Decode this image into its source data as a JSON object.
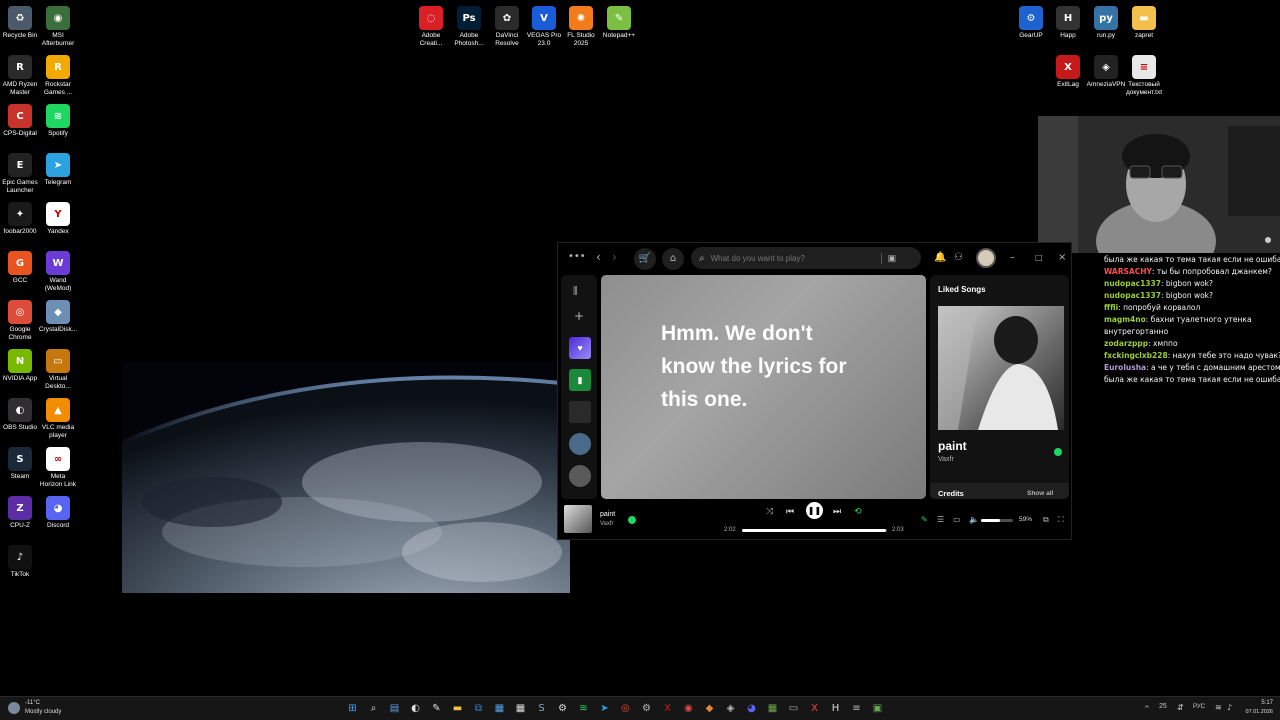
{
  "desktop": {
    "left_icons": [
      {
        "label": "Recycle Bin",
        "icon": "recycle-bin-icon",
        "color": "#4a5a6a",
        "glyph": "♻"
      },
      {
        "label": "MSI\nAfterburner",
        "icon": "msi-afterburner-icon",
        "color": "#3a6e3a",
        "glyph": "◉"
      },
      {
        "label": "AMD Ryzen\nMaster",
        "icon": "amd-ryzen-icon",
        "color": "#2a2a2a",
        "glyph": "R"
      },
      {
        "label": "Rockstar\nGames ...",
        "icon": "rockstar-icon",
        "color": "#f2a900",
        "glyph": "R"
      },
      {
        "label": "CPS-Digital",
        "icon": "cps-digital-icon",
        "color": "#c8332b",
        "glyph": "C"
      },
      {
        "label": "Spotify",
        "icon": "spotify-icon",
        "color": "#1ed760",
        "glyph": "≋"
      },
      {
        "label": "Epic Games\nLauncher",
        "icon": "epic-games-icon",
        "color": "#222222",
        "glyph": "E"
      },
      {
        "label": "Telegram",
        "icon": "telegram-icon",
        "color": "#2aa3e0",
        "glyph": "➤"
      },
      {
        "label": "foobar2000",
        "icon": "foobar-icon",
        "color": "#1a1a1a",
        "glyph": "✦"
      },
      {
        "label": "Yandex",
        "icon": "yandex-icon",
        "color": "#ffffff",
        "glyph": "Y"
      },
      {
        "label": "GCC",
        "icon": "gcc-icon",
        "color": "#e8531f",
        "glyph": "G"
      },
      {
        "label": "Wand\n(WeMod)",
        "icon": "wand-icon",
        "color": "#6b3bd8",
        "glyph": "W"
      },
      {
        "label": "Google\nChrome",
        "icon": "chrome-icon",
        "color": "#dd4b39",
        "glyph": "◎"
      },
      {
        "label": "CrystalDisk...",
        "icon": "crystaldisk-icon",
        "color": "#6c8fb5",
        "glyph": "◆"
      },
      {
        "label": "NVIDIA App",
        "icon": "nvidia-icon",
        "color": "#76b900",
        "glyph": "N"
      },
      {
        "label": "Virtual\nDeskto...",
        "icon": "virtual-desktop-icon",
        "color": "#c6780e",
        "glyph": "▭"
      },
      {
        "label": "OBS Studio",
        "icon": "obs-icon",
        "color": "#302e31",
        "glyph": "◐"
      },
      {
        "label": "VLC media\nplayer",
        "icon": "vlc-icon",
        "color": "#f28c00",
        "glyph": "▲"
      },
      {
        "label": "Steam",
        "icon": "steam-icon",
        "color": "#1b2838",
        "glyph": "S"
      },
      {
        "label": "Meta\nHorizon Link",
        "icon": "meta-icon",
        "color": "#ffffff",
        "glyph": "∞"
      },
      {
        "label": "CPU-Z",
        "icon": "cpuz-icon",
        "color": "#5b2ea6",
        "glyph": "Z"
      },
      {
        "label": "Discord",
        "icon": "discord-icon",
        "color": "#5865f2",
        "glyph": "◕"
      },
      {
        "label": "TikTok",
        "icon": "tiktok-icon",
        "color": "#111111",
        "glyph": "♪"
      }
    ],
    "top_icons": [
      {
        "label": "Adobe\nCreati...",
        "icon": "adobe-cc-icon",
        "color": "#da1f26",
        "glyph": "◌"
      },
      {
        "label": "Adobe\nPhotosh...",
        "icon": "photoshop-icon",
        "color": "#001e36",
        "glyph": "Ps"
      },
      {
        "label": "DaVinci\nResolve",
        "icon": "davinci-icon",
        "color": "#2b2b2b",
        "glyph": "✿"
      },
      {
        "label": "VEGAS Pro\n23.0",
        "icon": "vegas-icon",
        "color": "#1a5bd8",
        "glyph": "V"
      },
      {
        "label": "FL Studio\n2025",
        "icon": "fl-studio-icon",
        "color": "#f27b1b",
        "glyph": "✺"
      },
      {
        "label": "Notepad++",
        "icon": "notepad-icon",
        "color": "#7bc043",
        "glyph": "✎"
      }
    ],
    "right_icons": [
      {
        "label": "GearUP",
        "icon": "gearup-icon",
        "color": "#1e62d0",
        "glyph": "⚙"
      },
      {
        "label": "Happ",
        "icon": "happ-icon",
        "color": "#333333",
        "glyph": "H"
      },
      {
        "label": "run.py",
        "icon": "python-file-icon",
        "color": "#3572a5",
        "glyph": "py"
      },
      {
        "label": "zapret",
        "icon": "folder-icon",
        "color": "#f3c14b",
        "glyph": "▬"
      },
      {
        "label": "ExitLag",
        "icon": "exitlag-icon",
        "color": "#c61a1a",
        "glyph": "X"
      },
      {
        "label": "AmneziaVPN",
        "icon": "amnezia-icon",
        "color": "#222222",
        "glyph": "◈"
      },
      {
        "label": "Текстовый\nдокумент.txt",
        "icon": "text-file-icon",
        "color": "#e8e8e8",
        "glyph": "≡"
      }
    ]
  },
  "chat": {
    "messages": [
      {
        "nick": "",
        "text": "была же какая то тема такая если не ошибаюсь",
        "color": "#ffffff"
      },
      {
        "nick": "WARSACHY",
        "text": ": ты бы попробовал джанкем?",
        "color": "#ff4d4d"
      },
      {
        "nick": "nudopac1337",
        "text": ": bigbon wok?",
        "color": "#9acd32"
      },
      {
        "nick": "nudopac1337",
        "text": ": bigbon wok?",
        "color": "#9acd32"
      },
      {
        "nick": "fffii",
        "text": ": попробуй корвалол",
        "color": "#9acd32"
      },
      {
        "nick": "magm4no",
        "text": ": бахни туалетного утенка",
        "color": "#9acd32"
      },
      {
        "nick": "",
        "text": "внутрегортанно",
        "color": "#ffffff"
      },
      {
        "nick": "zodarzppp",
        "text": ": хмппо",
        "color": "#9acd32"
      },
      {
        "nick": "fxckingclxb228",
        "text": ": нахуя тебе это надо чувак?",
        "color": "#9acd32"
      },
      {
        "nick": "Eurolusha",
        "text": ": а че у тебя с домашним арестом",
        "color": "#b19cd9"
      },
      {
        "nick": "",
        "text": "была же какая то тема такая если не ошибаюсь",
        "color": "#ffffff"
      }
    ]
  },
  "spotify": {
    "search_placeholder": "What do you want to play?",
    "lyrics_message": "Hmm. We don't know the lyrics for this one.",
    "right_panel_title": "Liked Songs",
    "track_title": "paint",
    "track_artist": "Vaxfr",
    "credits_label": "Credits",
    "show_all_label": "Show all",
    "time_elapsed": "2:02",
    "time_total": "2:03",
    "progress": 0.99,
    "volume_label": "59%",
    "volume": 0.59,
    "accent": "#1ed760"
  },
  "taskbar": {
    "weather_temp": "-11°C",
    "weather_desc": "Mostly cloudy",
    "tray_number": "25",
    "language": "РУС",
    "time": "5:17",
    "date": "07.01.2026"
  }
}
